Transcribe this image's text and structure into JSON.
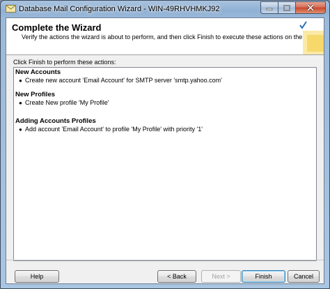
{
  "window": {
    "title": "Database Mail Configuration Wizard - WIN-49RHVHMKJ92",
    "icon": "database-mail-icon"
  },
  "header": {
    "title": "Complete the Wizard",
    "subtitle": "Verify the actions the wizard is about to perform, and then click Finish to execute these actions on the server."
  },
  "body": {
    "label": "Click Finish to perform these actions:",
    "groups": [
      {
        "title": "New Accounts",
        "items": [
          "Create new account 'Email Account' for SMTP server 'smtp.yahoo.com'"
        ]
      },
      {
        "title": "New Profiles",
        "items": [
          "Create New profile 'My Profile'"
        ]
      },
      {
        "title": "Adding Accounts Profiles",
        "items": [
          "Add account 'Email Account' to profile 'My Profile' with priority '1'"
        ]
      }
    ]
  },
  "buttons": {
    "help": "Help",
    "back": "< Back",
    "next": "Next >",
    "finish": "Finish",
    "cancel": "Cancel"
  },
  "colors": {
    "titlebar": "#9bbad9",
    "client_bg": "#f0f0f0",
    "close_red": "#c7472c"
  }
}
